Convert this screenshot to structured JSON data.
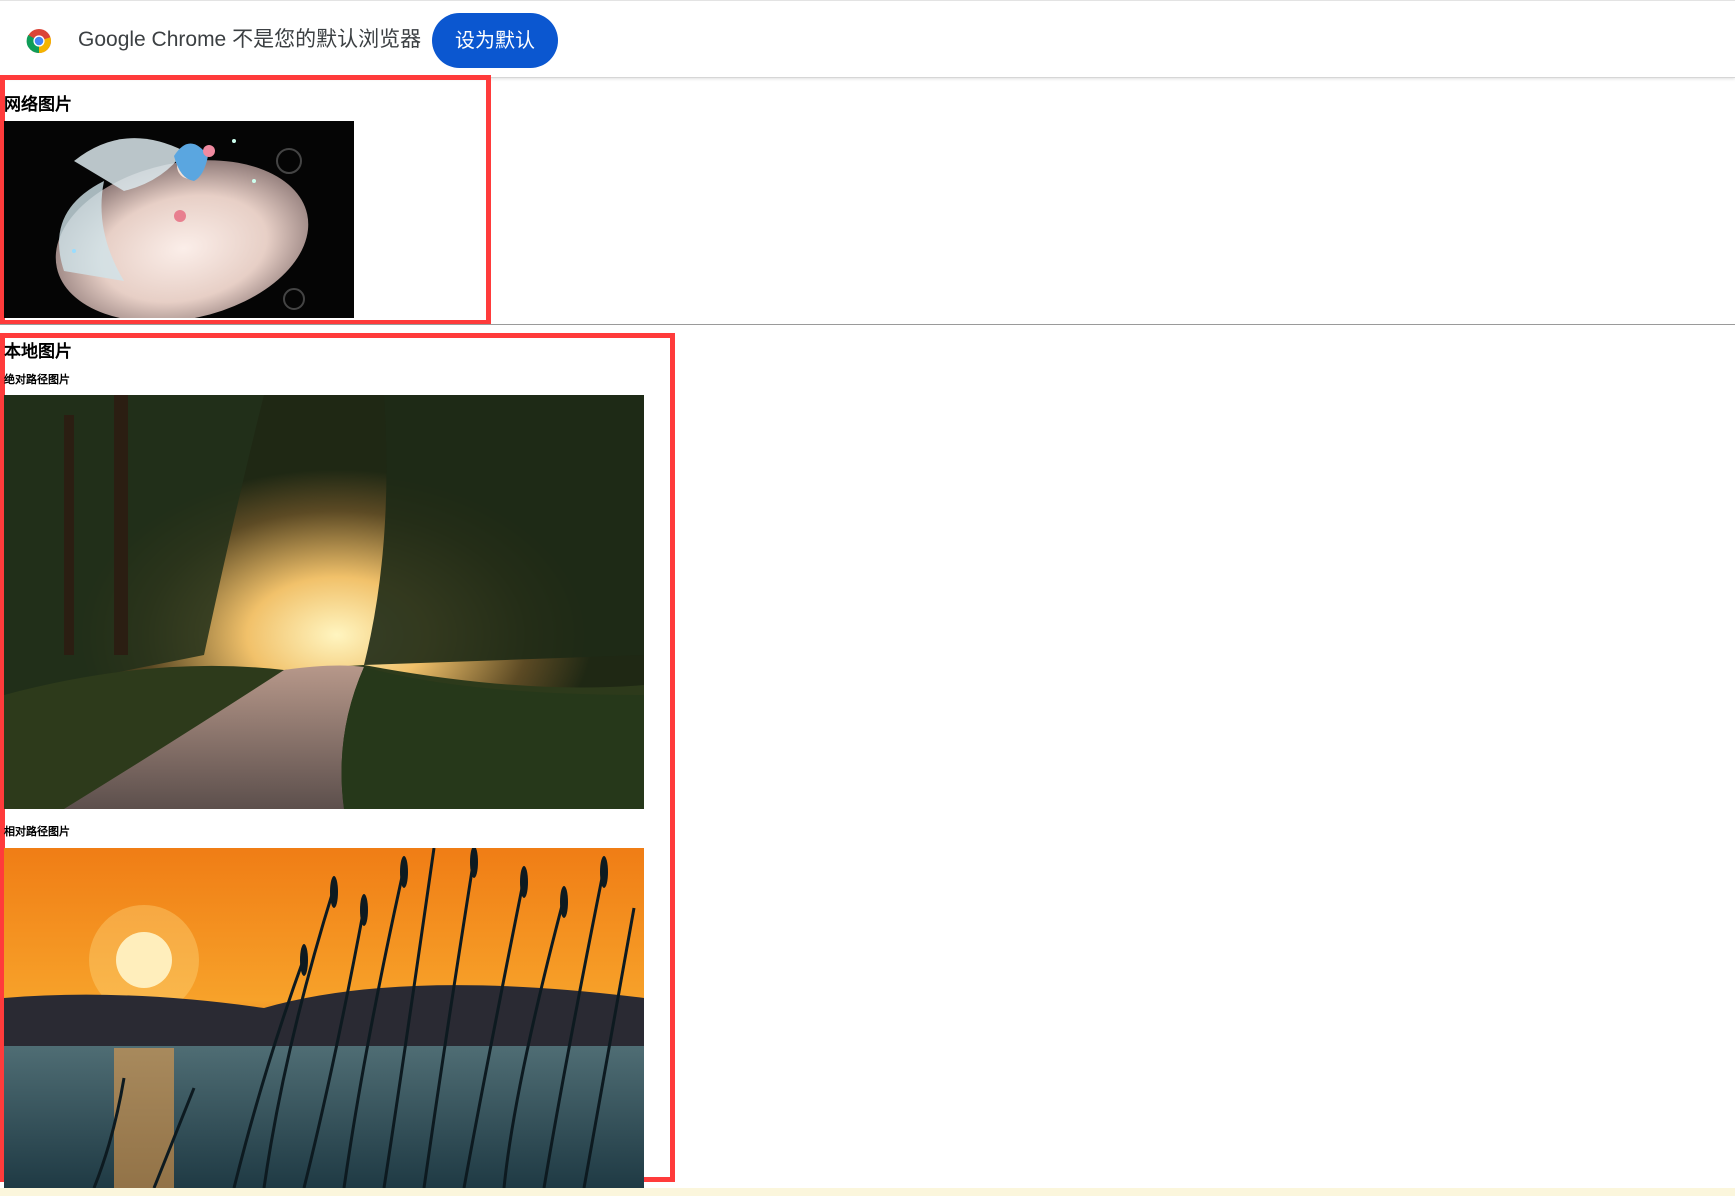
{
  "infobar": {
    "message": "Google Chrome 不是您的默认浏览器",
    "button_label": "设为默认",
    "accent_color": "#0b57d0"
  },
  "network_section": {
    "heading": "网络图片",
    "image_icon": "anime-girl-illustration"
  },
  "local_section": {
    "heading": "本地图片",
    "absolute_label": "绝对路径图片",
    "absolute_image_icon": "forest-road-photo",
    "relative_label": "相对路径图片",
    "relative_image_icon": "sunset-reeds-photo"
  },
  "highlight_color": "#ff3b3b"
}
